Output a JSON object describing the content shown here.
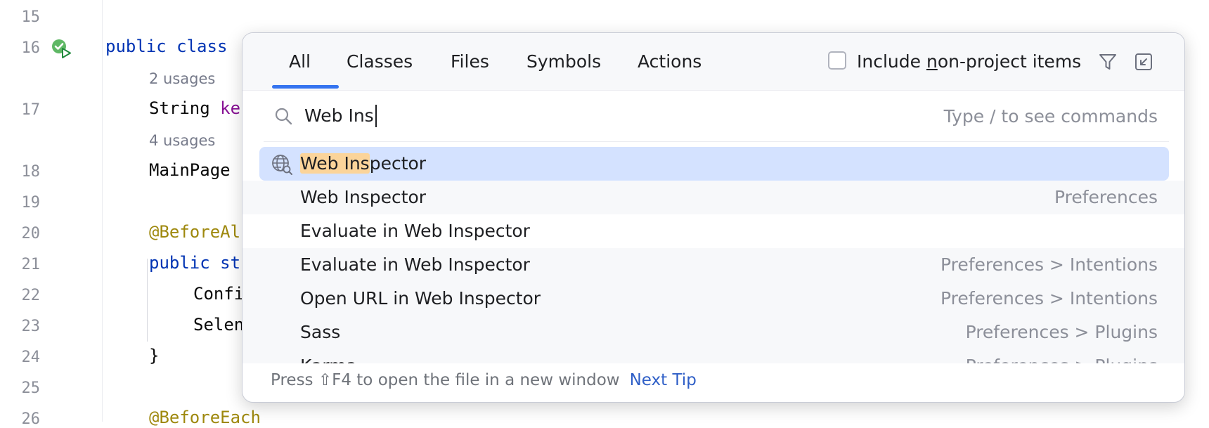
{
  "editor": {
    "lines": [
      {
        "n": "15",
        "text": ""
      },
      {
        "n": "16",
        "text": "public class"
      },
      {
        "n": "17",
        "text": "String ke"
      },
      {
        "n": "18",
        "text": "MainPage"
      },
      {
        "n": "19",
        "text": ""
      },
      {
        "n": "20",
        "text": "@BeforeAl"
      },
      {
        "n": "21",
        "text": "public st"
      },
      {
        "n": "22",
        "text": "Confi"
      },
      {
        "n": "23",
        "text": "Selen"
      },
      {
        "n": "24",
        "text": "}"
      },
      {
        "n": "25",
        "text": ""
      },
      {
        "n": "26",
        "text": "@BeforeEach"
      }
    ],
    "usages": [
      "2 usages",
      "4 usages"
    ],
    "code": {
      "l16_kw": "public class",
      "l17_type": "String ",
      "l17_field": "ke",
      "l18": "MainPage",
      "l20": "@BeforeAl",
      "l21": "public st",
      "l22": "Confi",
      "l23": "Selen",
      "l24": "}",
      "l26": "@BeforeEach"
    }
  },
  "popup": {
    "tabs": [
      "All",
      "Classes",
      "Files",
      "Symbols",
      "Actions"
    ],
    "active_tab": "All",
    "include_label_pre": "Include ",
    "include_label_u": "n",
    "include_label_post": "on-project items",
    "include_checked": false,
    "search": {
      "value": "Web Ins",
      "hint": "Type / to see commands"
    },
    "results": [
      {
        "label_hl": "Web Ins",
        "label_rest": "pector",
        "location": "",
        "icon": "globe-search-icon",
        "selected": true
      },
      {
        "label": "Web Inspector",
        "location": "Preferences"
      },
      {
        "label": "Evaluate in Web Inspector",
        "location": ""
      },
      {
        "label": "Evaluate in Web Inspector",
        "location": "Preferences > Intentions"
      },
      {
        "label": "Open URL in Web Inspector",
        "location": "Preferences > Intentions"
      },
      {
        "label": "Sass",
        "location": "Preferences > Plugins"
      },
      {
        "label": "Karma",
        "location": "Preferences > Plugins"
      }
    ],
    "footer": {
      "text": "Press ⇧F4 to open the file in a new window",
      "link": "Next Tip"
    }
  },
  "colors": {
    "accent": "#3574f0",
    "selection": "#d4e2ff",
    "match_highlight": "#fbd49a",
    "link": "#2f5fc7"
  }
}
